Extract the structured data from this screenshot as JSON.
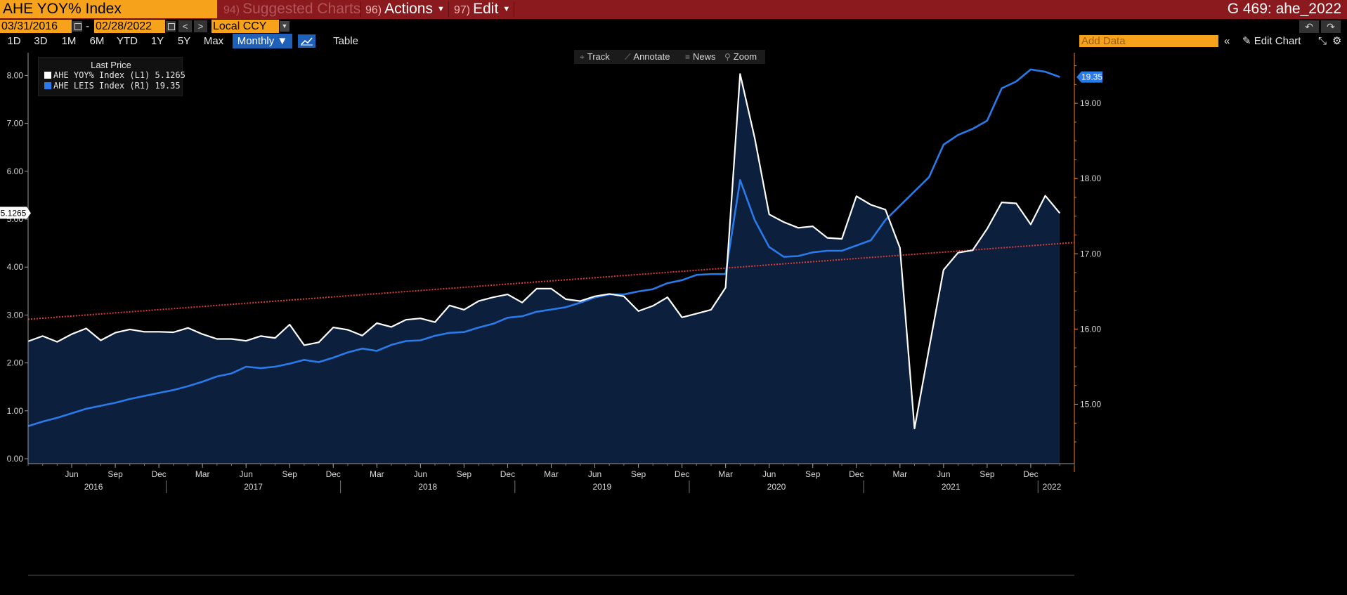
{
  "titlebar": {
    "ticker": "AHE YOY% Index",
    "suggested_num": "94)",
    "suggested_label": "Suggested Charts",
    "actions_num": "96)",
    "actions_label": "Actions",
    "edit_num": "97)",
    "edit_label": "Edit",
    "right_label": "G 469: ahe_2022"
  },
  "daterow": {
    "start_date": "03/31/2016",
    "separator": "-",
    "end_date": "02/28/2022",
    "prev": "<",
    "next": ">",
    "currency": "Local CCY",
    "undo": "↶",
    "redo": "↷"
  },
  "toolbar": {
    "periods": [
      "1D",
      "3D",
      "1M",
      "6M",
      "YTD",
      "1Y",
      "5Y",
      "Max"
    ],
    "frequency": "Monthly ▼",
    "table_label": "Table",
    "add_data_placeholder": "Add Data",
    "collapse": "«",
    "edit_chart": "Edit Chart"
  },
  "chart_tools": {
    "track": "Track",
    "annotate": "Annotate",
    "news": "News",
    "zoom": "Zoom"
  },
  "legend": {
    "title": "Last Price",
    "items": [
      {
        "label": "AHE YOY% Index  (L1) 5.1265",
        "color": "#ffffff"
      },
      {
        "label": "AHE LEIS Index  (R1) 19.35",
        "color": "#2a7bea"
      }
    ]
  },
  "colors": {
    "title_bar": "#8b1a1e",
    "accent_orange": "#f7a21b",
    "accent_blue": "#1f60b8",
    "yoy_line": "#ffffff",
    "leis_line": "#2a7bea",
    "area_fill": "#0c1f3d",
    "trend_line": "#e03a3a",
    "right_axis": "#ff7a1a"
  },
  "chart_data": {
    "type": "line",
    "x": [
      "2016-03",
      "2016-04",
      "2016-05",
      "2016-06",
      "2016-07",
      "2016-08",
      "2016-09",
      "2016-10",
      "2016-11",
      "2016-12",
      "2017-01",
      "2017-02",
      "2017-03",
      "2017-04",
      "2017-05",
      "2017-06",
      "2017-07",
      "2017-08",
      "2017-09",
      "2017-10",
      "2017-11",
      "2017-12",
      "2018-01",
      "2018-02",
      "2018-03",
      "2018-04",
      "2018-05",
      "2018-06",
      "2018-07",
      "2018-08",
      "2018-09",
      "2018-10",
      "2018-11",
      "2018-12",
      "2019-01",
      "2019-02",
      "2019-03",
      "2019-04",
      "2019-05",
      "2019-06",
      "2019-07",
      "2019-08",
      "2019-09",
      "2019-10",
      "2019-11",
      "2019-12",
      "2020-01",
      "2020-02",
      "2020-03",
      "2020-04",
      "2020-05",
      "2020-06",
      "2020-07",
      "2020-08",
      "2020-09",
      "2020-10",
      "2020-11",
      "2020-12",
      "2021-01",
      "2021-02",
      "2021-03",
      "2021-04",
      "2021-05",
      "2021-06",
      "2021-07",
      "2021-08",
      "2021-09",
      "2021-10",
      "2021-11",
      "2021-12",
      "2022-01",
      "2022-02"
    ],
    "series": [
      {
        "name": "AHE YOY% Index",
        "axis": "left",
        "last_value_label": "5.1265",
        "values": [
          2.45,
          2.56,
          2.44,
          2.6,
          2.72,
          2.47,
          2.63,
          2.7,
          2.65,
          2.65,
          2.64,
          2.73,
          2.6,
          2.5,
          2.5,
          2.46,
          2.56,
          2.52,
          2.8,
          2.37,
          2.43,
          2.74,
          2.69,
          2.57,
          2.83,
          2.75,
          2.9,
          2.93,
          2.85,
          3.2,
          3.11,
          3.29,
          3.37,
          3.43,
          3.26,
          3.55,
          3.55,
          3.33,
          3.29,
          3.39,
          3.44,
          3.39,
          3.08,
          3.19,
          3.37,
          2.95,
          3.03,
          3.11,
          3.57,
          8.03,
          6.7,
          5.1,
          4.94,
          4.82,
          4.85,
          4.61,
          4.59,
          5.48,
          5.3,
          5.2,
          4.4,
          0.63,
          2.3,
          3.94,
          4.3,
          4.35,
          4.8,
          5.35,
          5.33,
          4.89,
          5.49,
          5.1265
        ]
      },
      {
        "name": "AHE LEIS Index",
        "axis": "right",
        "last_value_label": "19.35",
        "values": [
          14.71,
          14.77,
          14.82,
          14.88,
          14.94,
          14.98,
          15.02,
          15.07,
          15.11,
          15.15,
          15.19,
          15.24,
          15.3,
          15.37,
          15.41,
          15.5,
          15.48,
          15.5,
          15.54,
          15.59,
          15.56,
          15.62,
          15.69,
          15.74,
          15.71,
          15.79,
          15.84,
          15.85,
          15.91,
          15.95,
          15.96,
          16.02,
          16.07,
          16.15,
          16.17,
          16.23,
          16.26,
          16.29,
          16.35,
          16.42,
          16.46,
          16.46,
          16.5,
          16.53,
          16.61,
          16.65,
          16.72,
          16.73,
          16.73,
          17.98,
          17.45,
          17.09,
          16.96,
          16.97,
          17.02,
          17.04,
          17.04,
          17.11,
          17.18,
          17.45,
          17.64,
          17.83,
          18.02,
          18.45,
          18.58,
          18.66,
          18.77,
          19.2,
          19.29,
          19.45,
          19.42,
          19.35
        ]
      },
      {
        "name": "",
        "axis": "right",
        "kind": "trend",
        "x": [
          "2016-03",
          "2022-03"
        ],
        "values": [
          16.13,
          17.15
        ]
      }
    ],
    "left_axis": {
      "ylim": [
        0,
        8.4
      ],
      "ticks": [
        "0.00",
        "1.00",
        "2.00",
        "3.00",
        "4.00",
        "5.00",
        "6.00",
        "7.00",
        "8.00"
      ]
    },
    "right_axis": {
      "ylim": [
        14.35,
        19.7
      ],
      "ticks": [
        "15.00",
        "16.00",
        "17.00",
        "18.00",
        "19.00"
      ]
    },
    "x_ticks": [
      {
        "x": "2016-06",
        "label": "Jun"
      },
      {
        "x": "2016-09",
        "label": "Sep"
      },
      {
        "x": "2016-12",
        "label": "Dec"
      },
      {
        "x": "2017-03",
        "label": "Mar"
      },
      {
        "x": "2017-06",
        "label": "Jun"
      },
      {
        "x": "2017-09",
        "label": "Sep"
      },
      {
        "x": "2017-12",
        "label": "Dec"
      },
      {
        "x": "2018-03",
        "label": "Mar"
      },
      {
        "x": "2018-06",
        "label": "Jun"
      },
      {
        "x": "2018-09",
        "label": "Sep"
      },
      {
        "x": "2018-12",
        "label": "Dec"
      },
      {
        "x": "2019-03",
        "label": "Mar"
      },
      {
        "x": "2019-06",
        "label": "Jun"
      },
      {
        "x": "2019-09",
        "label": "Sep"
      },
      {
        "x": "2019-12",
        "label": "Dec"
      },
      {
        "x": "2020-03",
        "label": "Mar"
      },
      {
        "x": "2020-06",
        "label": "Jun"
      },
      {
        "x": "2020-09",
        "label": "Sep"
      },
      {
        "x": "2020-12",
        "label": "Dec"
      },
      {
        "x": "2021-03",
        "label": "Mar"
      },
      {
        "x": "2021-06",
        "label": "Jun"
      },
      {
        "x": "2021-09",
        "label": "Sep"
      },
      {
        "x": "2021-12",
        "label": "Dec"
      }
    ],
    "year_labels": [
      "2016",
      "2017",
      "2018",
      "2019",
      "2020",
      "2021",
      "2022"
    ],
    "grid": false,
    "legend_position": "top-left"
  }
}
